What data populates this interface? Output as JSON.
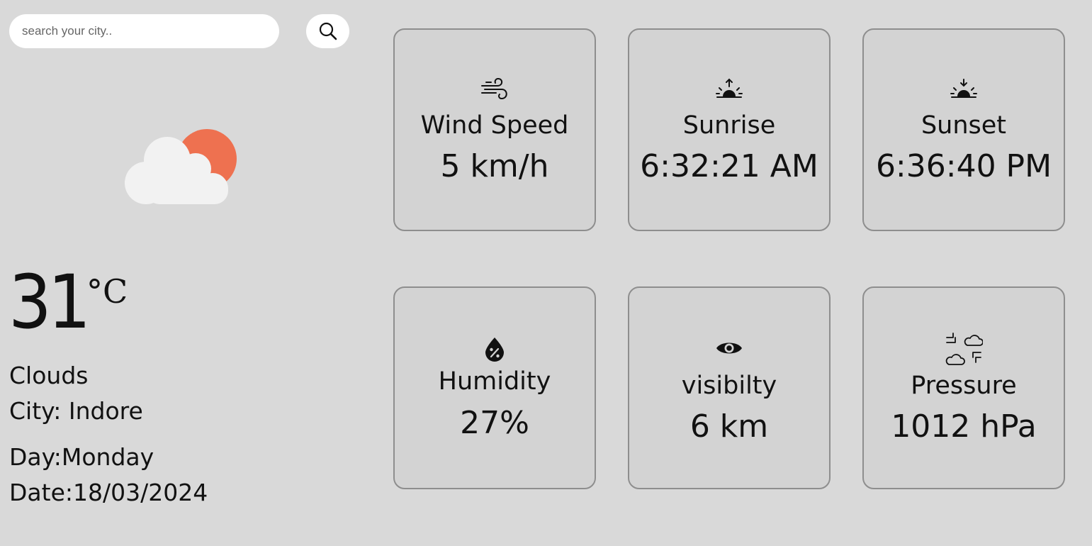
{
  "search": {
    "placeholder": "search your city..",
    "value": ""
  },
  "icons": {
    "search_button": "search-icon",
    "weather": "partly-cloudy-day-icon"
  },
  "colors": {
    "background": "#d9d9d9",
    "card_background": "#d3d3d3",
    "card_border": "#8e8e8e",
    "sun": "#ee7150",
    "cloud": "#f2f2f2"
  },
  "current": {
    "temperature": "31",
    "unit": "°C",
    "condition": "Clouds",
    "city": "City: Indore",
    "day": "Day:Monday",
    "date": "Date:18/03/2024"
  },
  "cards": [
    {
      "icon": "wind-icon",
      "label": "Wind Speed",
      "value": "5 km/h"
    },
    {
      "icon": "sunrise-icon",
      "label": "Sunrise",
      "value": "6:32:21 AM"
    },
    {
      "icon": "sunset-icon",
      "label": "Sunset",
      "value": "6:36:40 PM"
    },
    {
      "icon": "humidity-icon",
      "label": "Humidity",
      "value": "27%"
    },
    {
      "icon": "visibility-eye-icon",
      "label": "visibilty",
      "value": "6 km"
    },
    {
      "icon": "pressure-icon",
      "label": "Pressure",
      "value": "1012 hPa"
    }
  ]
}
